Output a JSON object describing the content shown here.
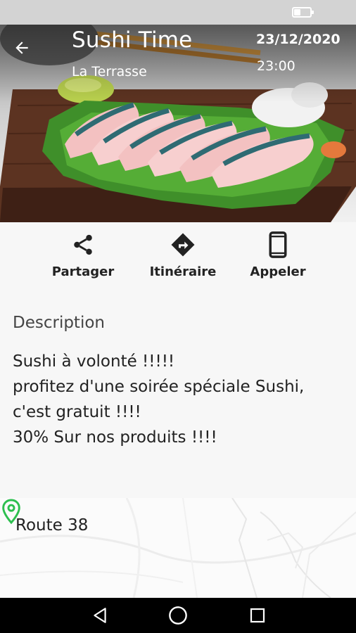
{
  "status_bar": {
    "battery_icon": "battery-icon"
  },
  "hero": {
    "image": "sashimi-plate-illustration",
    "back_icon": "arrow-left-icon",
    "title": "Sushi Time",
    "venue": "La Terrasse",
    "date": "23/12/2020",
    "time": "23:00"
  },
  "actions": [
    {
      "label": "Partager",
      "icon": "share-icon"
    },
    {
      "label": "Itinéraire",
      "icon": "directions-icon"
    },
    {
      "label": "Appeler",
      "icon": "phone-icon"
    }
  ],
  "description": {
    "title": "Description",
    "lines": [
      "Sushi à volonté !!!!!",
      "profitez d'une soirée spéciale Sushi,",
      "c'est gratuit !!!!",
      "30% Sur nos produits !!!!"
    ]
  },
  "location": {
    "address": "Route 38",
    "pin_icon": "map-pin-icon",
    "pin_color": "#2dbf4f"
  },
  "nav_bar": {
    "back_icon": "nav-back-icon",
    "home_icon": "nav-home-icon",
    "recents_icon": "nav-recents-icon"
  }
}
